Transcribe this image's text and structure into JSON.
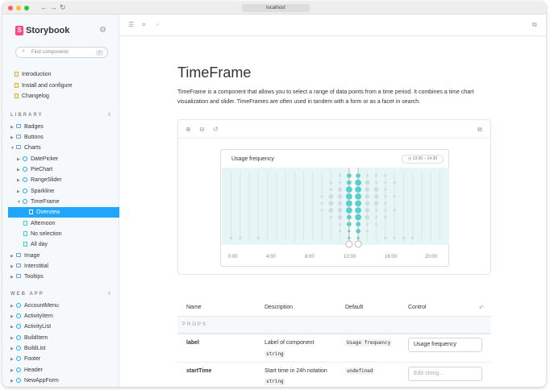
{
  "browser": {
    "url": "localhost",
    "back_glyph": "←",
    "forward_glyph": "→",
    "reload_glyph": "↻"
  },
  "sidebar": {
    "brand": "Storybook",
    "search_placeholder": "Find components",
    "search_shortcut": "/",
    "top_items": [
      "Introduction",
      "Install and configure",
      "Changelog"
    ],
    "library_heading": "LIBRARY",
    "library_items": [
      {
        "label": "Badges",
        "level": 0,
        "kind": "folder",
        "expanded": false
      },
      {
        "label": "Buttons",
        "level": 0,
        "kind": "folder",
        "expanded": false
      },
      {
        "label": "Charts",
        "level": 0,
        "kind": "folder",
        "expanded": true
      },
      {
        "label": "DatePicker",
        "level": 1,
        "kind": "component",
        "expanded": false
      },
      {
        "label": "PieChart",
        "level": 1,
        "kind": "component",
        "expanded": false
      },
      {
        "label": "RangeSlider",
        "level": 1,
        "kind": "component",
        "expanded": false
      },
      {
        "label": "Sparkline",
        "level": 1,
        "kind": "component",
        "expanded": false
      },
      {
        "label": "TimeFrame",
        "level": 1,
        "kind": "component",
        "expanded": true
      },
      {
        "label": "Overview",
        "level": 2,
        "kind": "story",
        "selected": true
      },
      {
        "label": "Afternoon",
        "level": 2,
        "kind": "story"
      },
      {
        "label": "No selection",
        "level": 2,
        "kind": "story"
      },
      {
        "label": "All day",
        "level": 2,
        "kind": "story"
      },
      {
        "label": "Image",
        "level": 0,
        "kind": "folder",
        "expanded": false
      },
      {
        "label": "Interstitial",
        "level": 0,
        "kind": "folder",
        "expanded": false
      },
      {
        "label": "Tooltips",
        "level": 0,
        "kind": "folder",
        "expanded": false
      }
    ],
    "webapp_heading": "WEB APP",
    "webapp_items": [
      "AccountMenu",
      "ActivityItem",
      "ActivityList",
      "BuildItem",
      "BuildList",
      "Footer",
      "Header",
      "NewAppForm"
    ]
  },
  "docs": {
    "title": "TimeFrame",
    "description": "TimeFrame is a component that allows you to select a range of data points from a time period. It combines a time chart visualization and slider. TimeFrames are often used in tandem with a form or as a facet in search.",
    "widget": {
      "title": "Usage frequency",
      "range_badge": "13:30 – 14:30",
      "axis_ticks": [
        "0:00",
        "4:00",
        "8:00",
        "12:00",
        "16:00",
        "20:00"
      ]
    }
  },
  "chart_data": {
    "type": "scatter",
    "title": "Usage frequency",
    "x_ticks": [
      "0:00",
      "4:00",
      "8:00",
      "12:00",
      "16:00",
      "20:00"
    ],
    "selected_range": [
      "13:30",
      "14:30"
    ],
    "columns": [
      {
        "x": 0.5,
        "sizes": [
          0,
          0,
          0,
          0,
          0,
          0,
          0,
          0,
          0,
          1
        ]
      },
      {
        "x": 1.5,
        "sizes": [
          0,
          0,
          0,
          0,
          0,
          0,
          0,
          0,
          0,
          1
        ]
      },
      {
        "x": 2.5,
        "sizes": [
          0,
          0,
          0,
          0,
          0,
          0,
          0,
          0,
          0,
          0
        ]
      },
      {
        "x": 3.5,
        "sizes": [
          0,
          0,
          0,
          0,
          0,
          0,
          0,
          0,
          0,
          1
        ]
      },
      {
        "x": 4.5,
        "sizes": [
          0,
          0,
          0,
          0,
          0,
          0,
          0,
          0,
          0,
          0
        ]
      },
      {
        "x": 5.5,
        "sizes": [
          0,
          0,
          0,
          0,
          0,
          0,
          0,
          0,
          0,
          0
        ]
      },
      {
        "x": 6.5,
        "sizes": [
          0,
          0,
          0,
          0,
          0,
          0,
          0,
          0,
          0,
          0
        ]
      },
      {
        "x": 7.5,
        "sizes": [
          0,
          0,
          0,
          0,
          0,
          0,
          0,
          0,
          0,
          0
        ]
      },
      {
        "x": 8.5,
        "sizes": [
          0,
          0,
          0,
          0,
          0,
          0,
          0,
          0,
          0,
          0
        ]
      },
      {
        "x": 9.5,
        "sizes": [
          0,
          0,
          0,
          0,
          0,
          0,
          0,
          0,
          0,
          0
        ]
      },
      {
        "x": 10.5,
        "sizes": [
          0,
          0,
          0,
          1,
          1,
          1,
          0,
          0,
          0,
          0
        ]
      },
      {
        "x": 11.5,
        "sizes": [
          0,
          1,
          1,
          2,
          2,
          2,
          1,
          0,
          0,
          0
        ]
      },
      {
        "x": 12.5,
        "sizes": [
          1,
          1,
          2,
          2,
          2,
          2,
          2,
          1,
          1,
          0
        ]
      },
      {
        "x": 13.5,
        "sizes": [
          2,
          2,
          3,
          3,
          3,
          3,
          2,
          2,
          1,
          1
        ]
      },
      {
        "x": 14.5,
        "sizes": [
          2,
          3,
          3,
          3,
          3,
          3,
          3,
          2,
          2,
          1
        ]
      },
      {
        "x": 15.5,
        "sizes": [
          1,
          2,
          2,
          2,
          2,
          2,
          2,
          1,
          1,
          0
        ]
      },
      {
        "x": 16.5,
        "sizes": [
          1,
          1,
          2,
          2,
          2,
          1,
          1,
          1,
          0,
          0
        ]
      },
      {
        "x": 17.5,
        "sizes": [
          1,
          1,
          1,
          1,
          1,
          1,
          1,
          0,
          0,
          1
        ]
      },
      {
        "x": 18.5,
        "sizes": [
          0,
          1,
          0,
          1,
          0,
          1,
          0,
          0,
          0,
          1
        ]
      },
      {
        "x": 19.5,
        "sizes": [
          0,
          0,
          0,
          0,
          0,
          0,
          0,
          0,
          0,
          1
        ]
      },
      {
        "x": 20.5,
        "sizes": [
          0,
          0,
          0,
          0,
          0,
          0,
          0,
          0,
          0,
          1
        ]
      },
      {
        "x": 21.5,
        "sizes": [
          0,
          0,
          0,
          0,
          0,
          0,
          0,
          0,
          0,
          0
        ]
      },
      {
        "x": 22.5,
        "sizes": [
          0,
          0,
          0,
          0,
          0,
          0,
          0,
          0,
          0,
          0
        ]
      },
      {
        "x": 23.5,
        "sizes": [
          0,
          0,
          0,
          0,
          0,
          0,
          0,
          0,
          0,
          0
        ]
      }
    ],
    "xlim": [
      0,
      24
    ],
    "colors": {
      "highlight": "#37d5d3",
      "muted": "#d2dadc",
      "band": "#e6f6f7"
    }
  },
  "args_table": {
    "headers": [
      "Name",
      "Description",
      "Default",
      "Control"
    ],
    "section": "PROPS",
    "rows": [
      {
        "name": "label",
        "description": "Label of component",
        "type": "string",
        "default": "Usage frequency",
        "control_value": "Usage frequency",
        "control_placeholder": ""
      },
      {
        "name": "startTime",
        "description": "Start time in 24h notation",
        "type": "string",
        "default": "undefined",
        "control_value": "",
        "control_placeholder": "Edit string..."
      }
    ]
  }
}
